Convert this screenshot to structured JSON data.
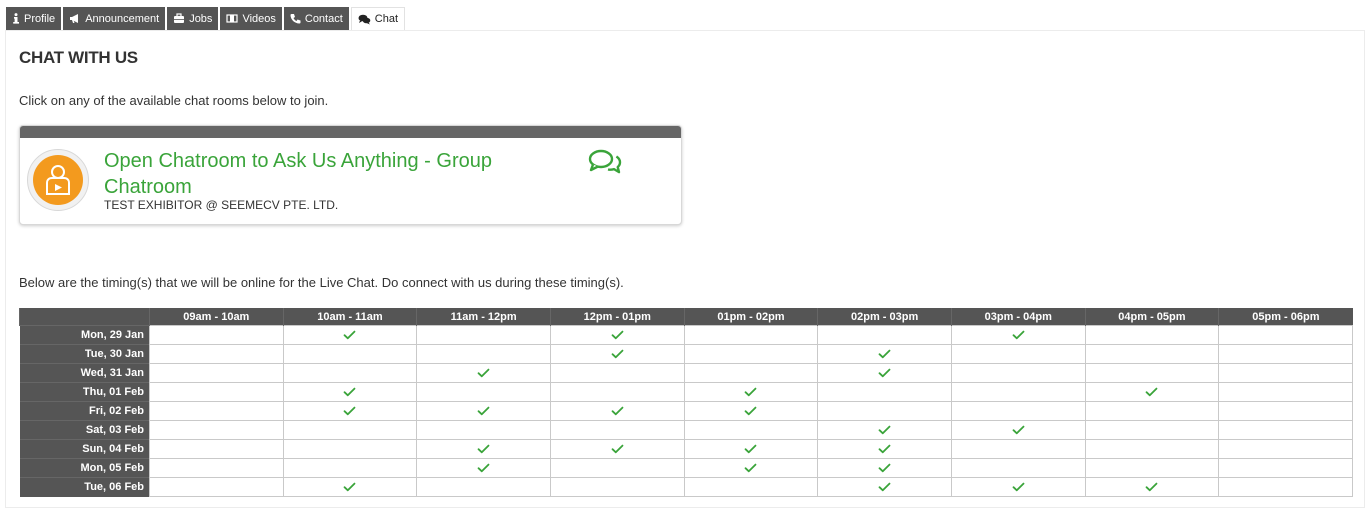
{
  "tabs": [
    {
      "label": "Profile",
      "icon": "info-icon"
    },
    {
      "label": "Announcement",
      "icon": "bullhorn-icon"
    },
    {
      "label": "Jobs",
      "icon": "briefcase-icon"
    },
    {
      "label": "Videos",
      "icon": "film-icon"
    },
    {
      "label": "Contact",
      "icon": "phone-icon"
    },
    {
      "label": "Chat",
      "icon": "comments-icon",
      "active": true
    }
  ],
  "page": {
    "title": "CHAT WITH US",
    "intro": "Click on any of the available chat rooms below to join.",
    "timing_note": "Below are the timing(s) that we will be online for the Live Chat. Do connect with us during these timing(s)."
  },
  "chatroom": {
    "name": "Open Chatroom to Ask Us Anything - Group Chatroom",
    "subtitle": "TEST EXHIBITOR @ SEEMECV PTE. LTD.",
    "avatar_icon": "chatroom-user-icon",
    "action_icon": "chat-bubbles-icon"
  },
  "schedule": {
    "slots": [
      "09am - 10am",
      "10am - 11am",
      "11am - 12pm",
      "12pm - 01pm",
      "01pm - 02pm",
      "02pm - 03pm",
      "03pm - 04pm",
      "04pm - 05pm",
      "05pm - 06pm"
    ],
    "days": [
      {
        "label": "Mon, 29 Jan",
        "available": [
          false,
          true,
          false,
          true,
          false,
          false,
          true,
          false,
          false
        ]
      },
      {
        "label": "Tue, 30 Jan",
        "available": [
          false,
          false,
          false,
          true,
          false,
          true,
          false,
          false,
          false
        ]
      },
      {
        "label": "Wed, 31 Jan",
        "available": [
          false,
          false,
          true,
          false,
          false,
          true,
          false,
          false,
          false
        ]
      },
      {
        "label": "Thu, 01 Feb",
        "available": [
          false,
          true,
          false,
          false,
          true,
          false,
          false,
          true,
          false
        ]
      },
      {
        "label": "Fri, 02 Feb",
        "available": [
          false,
          true,
          true,
          true,
          true,
          false,
          false,
          false,
          false
        ]
      },
      {
        "label": "Sat, 03 Feb",
        "available": [
          false,
          false,
          false,
          false,
          false,
          true,
          true,
          false,
          false
        ]
      },
      {
        "label": "Sun, 04 Feb",
        "available": [
          false,
          false,
          true,
          true,
          true,
          true,
          false,
          false,
          false
        ]
      },
      {
        "label": "Mon, 05 Feb",
        "available": [
          false,
          false,
          true,
          false,
          true,
          true,
          false,
          false,
          false
        ]
      },
      {
        "label": "Tue, 06 Feb",
        "available": [
          false,
          true,
          false,
          false,
          false,
          true,
          true,
          true,
          false
        ]
      }
    ]
  },
  "colors": {
    "accent_green": "#3aa43a",
    "tab_dark": "#555555",
    "avatar_orange": "#f39a1e"
  }
}
